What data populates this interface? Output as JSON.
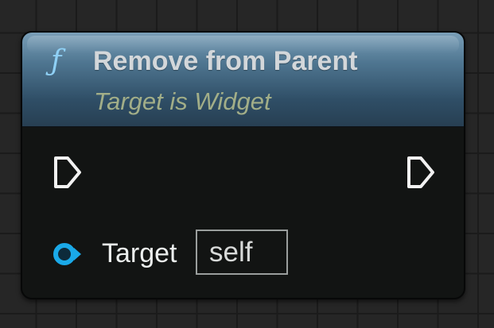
{
  "node": {
    "icon": "function-icon",
    "icon_glyph": "ƒ",
    "title": "Remove from Parent",
    "subtitle": "Target is Widget",
    "header_color": "#4f7691",
    "exec_in": {
      "icon": "exec-pin-icon"
    },
    "exec_out": {
      "icon": "exec-pin-icon"
    },
    "inputs": [
      {
        "label": "Target",
        "icon": "object-pin-icon",
        "pin_color": "#1aa9e8",
        "default_value": "self"
      }
    ]
  }
}
